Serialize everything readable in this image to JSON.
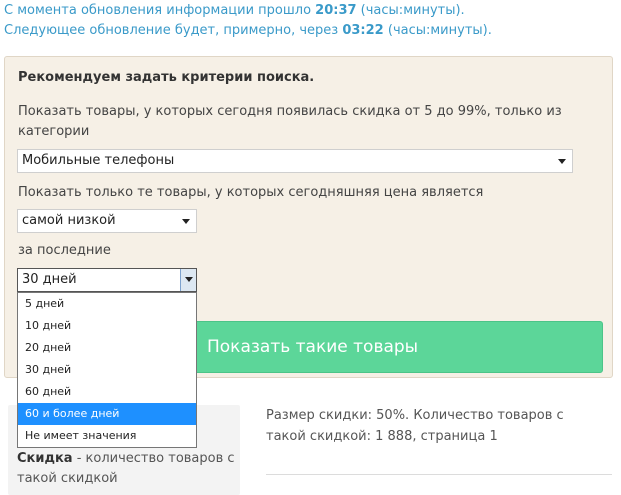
{
  "info": {
    "line1_prefix": "С момента обновления информации прошло ",
    "line1_value": "20:37",
    "line1_suffix": " (часы:минуты).",
    "line2_prefix": "Следующее обновление будет, примерно, через ",
    "line2_value": "03:22",
    "line2_suffix": " (часы:минуты)."
  },
  "panel": {
    "title": "Рекомендуем задать критерии поиска.",
    "category_text_1": "Показать товары, у которых сегодня появилась скидка от 5 до 99%, только из",
    "category_text_2": "категории",
    "category_value": "Мобильные телефоны",
    "price_text": "Показать только те товары, у которых сегодняшняя цена является",
    "price_value": "самой низкой",
    "period_text": "за последние",
    "period_value": "30 дней",
    "period_options": [
      "5 дней",
      "10 дней",
      "20 дней",
      "30 дней",
      "60 дней",
      "60 и более дней",
      "Не имеет значения"
    ],
    "highlighted_option": "60 и более дней",
    "show_button": "Показать такие товары"
  },
  "lower": {
    "left_bold": "Скидка",
    "left_text": " - количество товаров с такой скидкой",
    "right_text": "Размер скидки: 50%. Количество товаров с такой скидкой: 1 888, страница 1"
  }
}
